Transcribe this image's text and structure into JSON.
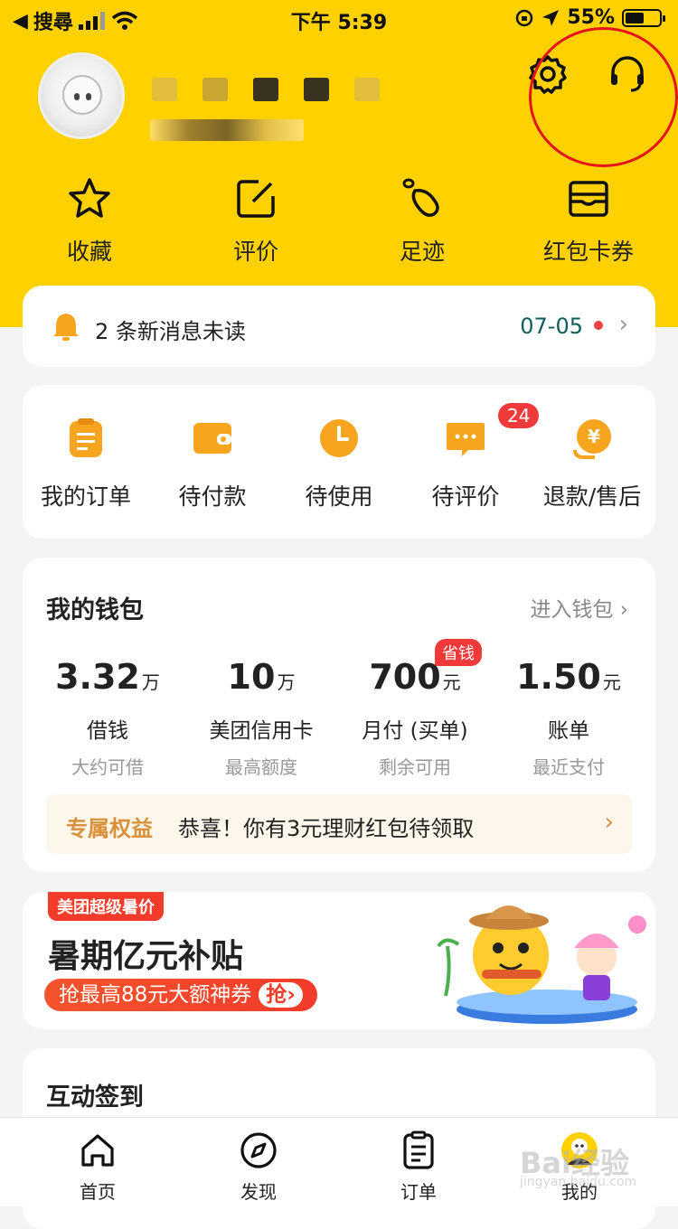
{
  "status_bar": {
    "back_app": "搜尋",
    "time": "下午 5:39",
    "battery": "55%"
  },
  "quick_links": [
    {
      "label": "收藏",
      "icon": "star-icon"
    },
    {
      "label": "评价",
      "icon": "edit-icon"
    },
    {
      "label": "足迹",
      "icon": "footprint-icon"
    },
    {
      "label": "红包卡券",
      "icon": "wallet-card-icon"
    }
  ],
  "message": {
    "text": "2 条新消息未读",
    "date": "07-05"
  },
  "orders": {
    "items": [
      {
        "label": "我的订单",
        "icon": "order-icon"
      },
      {
        "label": "待付款",
        "icon": "wallet-icon"
      },
      {
        "label": "待使用",
        "icon": "clock-icon"
      },
      {
        "label": "待评价",
        "icon": "comment-icon"
      },
      {
        "label": "退款/售后",
        "icon": "refund-icon"
      }
    ],
    "review_badge": "24"
  },
  "wallet": {
    "title": "我的钱包",
    "enter": "进入钱包",
    "save_tag": "省钱",
    "items": [
      {
        "num": "3.32",
        "unit": "万",
        "name": "借钱",
        "sub": "大约可借"
      },
      {
        "num": "10",
        "unit": "万",
        "name": "美团信用卡",
        "sub": "最高额度"
      },
      {
        "num": "700",
        "unit": "元",
        "name": "月付 (买单)",
        "sub": "剩余可用"
      },
      {
        "num": "1.50",
        "unit": "元",
        "name": "账单",
        "sub": "最近支付"
      }
    ],
    "perk_key": "专属权益",
    "perk_text": "恭喜！你有3元理财红包待领取"
  },
  "promo": {
    "tag": "美团超级暑价",
    "title": "暑期亿元补贴",
    "pill": "抢最高88元大额神券",
    "grab": "抢"
  },
  "sign": {
    "title": "互动签到"
  },
  "tabbar": [
    {
      "label": "首页",
      "icon": "home-icon"
    },
    {
      "label": "发现",
      "icon": "compass-icon"
    },
    {
      "label": "订单",
      "icon": "order-list-icon"
    },
    {
      "label": "我的",
      "icon": "profile-icon"
    }
  ],
  "watermark": {
    "main": "Bai经验",
    "sub": "jingyan.baidu.com"
  },
  "colors": {
    "brand": "#ffd100",
    "accent": "#f23b2a",
    "icon_orange": "#f7a41e"
  }
}
